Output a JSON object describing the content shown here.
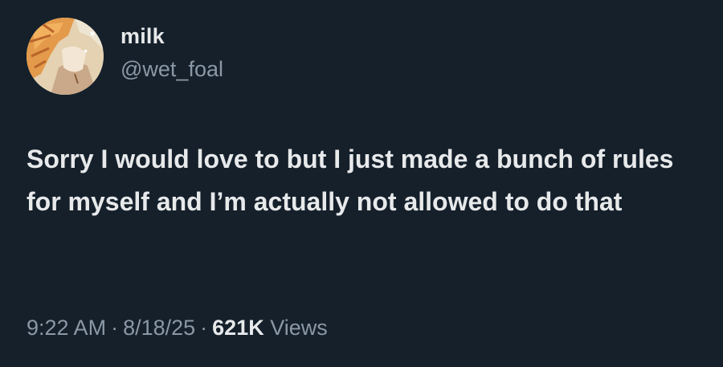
{
  "author": {
    "display_name": "milk",
    "handle": "@wet_foal",
    "avatar_icon": "anime-character-avatar-icon"
  },
  "tweet": {
    "text": "Sorry I would love to but I just made a bunch of rules for myself and I’m actually not allowed to do that"
  },
  "meta": {
    "time": "9:22 AM",
    "separator": "·",
    "date": "8/18/25",
    "view_count": "621K",
    "views_label": "Views"
  },
  "colors": {
    "background": "#15202b",
    "primary_text": "#e7e9ea",
    "secondary_text": "#8b98a5"
  }
}
